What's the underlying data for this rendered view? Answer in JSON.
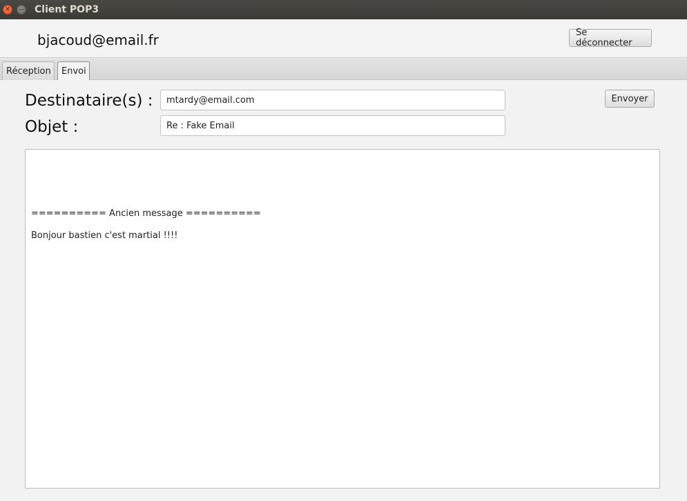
{
  "window": {
    "title": "Client POP3",
    "close_icon": "close-icon",
    "minimize_icon": "minimize-icon"
  },
  "header": {
    "account": "bjacoud@email.fr",
    "logout_label": "Se déconnecter"
  },
  "tabs": [
    {
      "label": "Réception",
      "active": false
    },
    {
      "label": "Envoi",
      "active": true
    }
  ],
  "compose": {
    "to_label": "Destinataire(s) :",
    "to_value": "mtardy@email.com",
    "subject_label": "Objet :",
    "subject_value": "Re : Fake Email",
    "send_label": "Envoyer",
    "body_lines": [
      "========== Ancien message ==========",
      "Bonjour bastien c'est martial !!!!"
    ]
  },
  "colors": {
    "active_tab_border": "#4aa0d8",
    "titlebar": "#3b3a36",
    "close_button": "#e2532a"
  }
}
